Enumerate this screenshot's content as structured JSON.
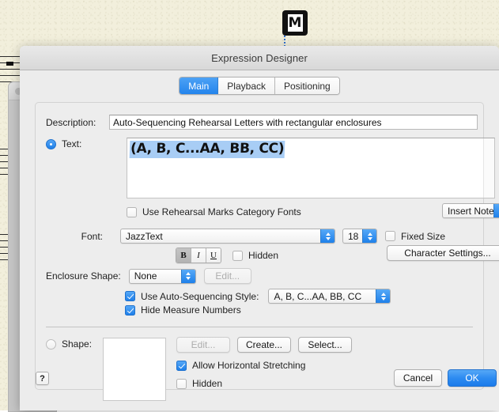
{
  "window": {
    "title": "Expression Designer"
  },
  "tabs": [
    {
      "label": "Main",
      "selected": true
    },
    {
      "label": "Playback",
      "selected": false
    },
    {
      "label": "Positioning",
      "selected": false
    }
  ],
  "main": {
    "description": {
      "label": "Description:",
      "value": "Auto-Sequencing Rehearsal Letters with rectangular enclosures"
    },
    "text_option": {
      "label": "Text:",
      "selected": true,
      "content": "(A, B, C...AA, BB, CC)"
    },
    "use_rehearsal_marks_category_fonts": {
      "label": "Use Rehearsal Marks Category Fonts",
      "checked": false
    },
    "insert_note": {
      "label": "Insert Note"
    },
    "font": {
      "label": "Font:",
      "value": "JazzText",
      "size": "18",
      "fixed_size": {
        "label": "Fixed Size",
        "checked": false
      },
      "bold_label": "B",
      "italic_label": "I",
      "underline_label": "U",
      "bold_active": true,
      "italic_active": false,
      "underline_active": false,
      "hidden": {
        "label": "Hidden",
        "checked": false
      },
      "character_settings_label": "Character Settings..."
    },
    "enclosure": {
      "label": "Enclosure Shape:",
      "value": "None",
      "edit_label": "Edit...",
      "edit_disabled": true
    },
    "auto_sequencing": {
      "label": "Use Auto-Sequencing Style:",
      "checked": true,
      "value": "A, B, C...AA, BB, CC"
    },
    "hide_measure_numbers": {
      "label": "Hide Measure Numbers",
      "checked": true
    },
    "shape_option": {
      "label": "Shape:",
      "selected": false,
      "edit_label": "Edit...",
      "edit_disabled": true,
      "create_label": "Create...",
      "select_label": "Select...",
      "allow_horizontal_stretching": {
        "label": "Allow Horizontal Stretching",
        "checked": true
      },
      "hidden": {
        "label": "Hidden",
        "checked": false
      }
    }
  },
  "footer": {
    "help_label": "?",
    "cancel_label": "Cancel",
    "ok_label": "OK"
  },
  "background": {
    "rehearsal_mark_letter": "M"
  },
  "colors": {
    "accent_blue": "#2384ec",
    "selection_blue": "#a8cdf5",
    "dialog_bg": "#ececec",
    "paper": "#f2efdc"
  }
}
